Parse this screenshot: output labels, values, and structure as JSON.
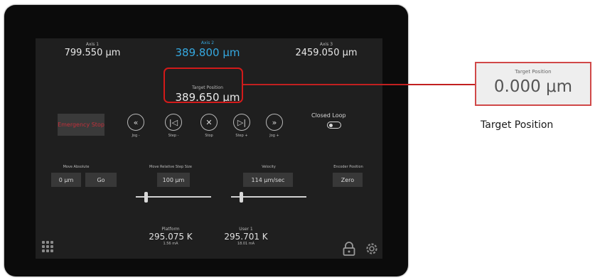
{
  "axes": [
    {
      "label": "Axis 1",
      "value": "799.550 μm"
    },
    {
      "label": "Axis 2",
      "value": "389.800 μm"
    },
    {
      "label": "Axis 3",
      "value": "2459.050 μm"
    }
  ],
  "target": {
    "label": "Target Position",
    "value": "389.650 μm"
  },
  "emergency_stop": "Emergency Stop",
  "controls": [
    {
      "icon": "jog-minus-icon",
      "glyph": "«",
      "label": "Jog -"
    },
    {
      "icon": "step-minus-icon",
      "glyph": "|◁",
      "label": "Step -"
    },
    {
      "icon": "stop-icon",
      "glyph": "✕",
      "label": "Stop"
    },
    {
      "icon": "step-plus-icon",
      "glyph": "▷|",
      "label": "Step +"
    },
    {
      "icon": "jog-plus-icon",
      "glyph": "»",
      "label": "Jog +"
    }
  ],
  "closed_loop": {
    "label": "Closed Loop"
  },
  "move_absolute": {
    "label": "Move Absolute",
    "value": "0 μm",
    "go": "Go"
  },
  "step_size": {
    "label": "Move Relative Step Size",
    "value": "100 μm"
  },
  "velocity": {
    "label": "Velocity",
    "value": "114 μm/sec"
  },
  "encoder": {
    "label": "Encoder Position",
    "button": "Zero"
  },
  "temps": [
    {
      "label": "Platform",
      "value": "295.075 K",
      "sub": "1.56 mA"
    },
    {
      "label": "User 1",
      "value": "295.701 K",
      "sub": "18.01 mA"
    }
  ],
  "callout": {
    "label": "Target Position",
    "value": "0.000 μm",
    "caption": "Target Position"
  },
  "colors": {
    "accent": "#35a8e0",
    "highlight": "#d21a1a",
    "estop_text": "#c0303a"
  }
}
